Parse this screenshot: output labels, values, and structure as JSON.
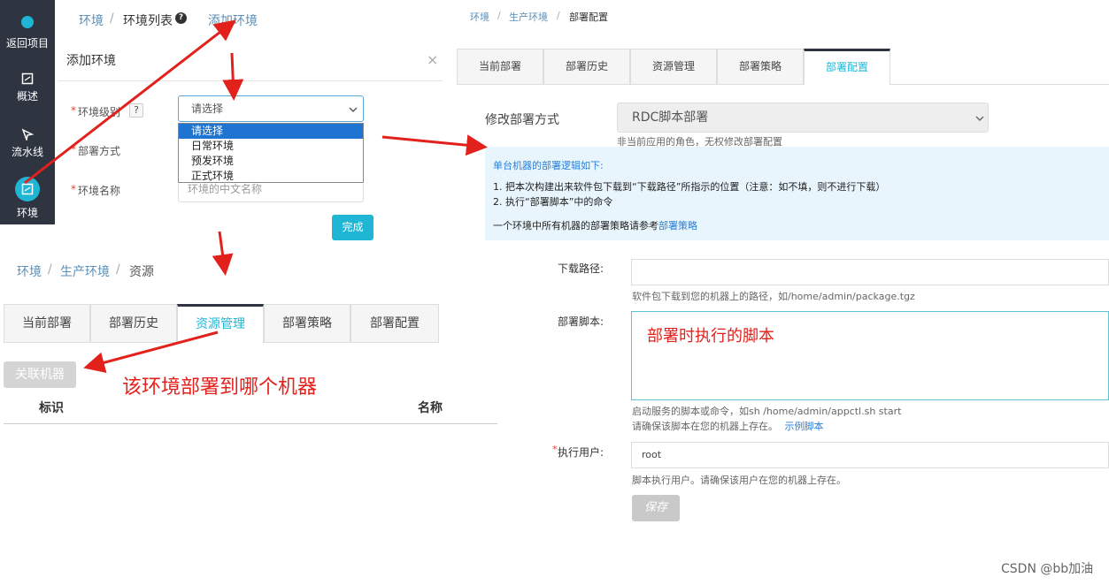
{
  "sidebar": {
    "items": [
      {
        "label": "返回项目",
        "icon": "back-icon"
      },
      {
        "label": "概述",
        "icon": "overview-icon"
      },
      {
        "label": "流水线",
        "icon": "pipeline-icon"
      },
      {
        "label": "环境",
        "icon": "environment-icon"
      }
    ],
    "accent": "#1fb6d6",
    "bg": "#2e3440"
  },
  "top_breadcrumb": {
    "root": "环境",
    "sep": "/",
    "list": "环境列表",
    "help_icon": "question-circle-icon",
    "action": "添加环境"
  },
  "dialog": {
    "title": "添加环境",
    "close": "×",
    "level_label": "环境级别",
    "help": "?",
    "select_value": "请选择",
    "options": [
      "请选择",
      "日常环境",
      "预发环境",
      "正式环境"
    ],
    "deploy_method_label": "部署方式",
    "env_name_label": "环境名称",
    "env_name_placeholder": "环境的中文名称",
    "required_mark": "*",
    "finish": "完成"
  },
  "bottom_left": {
    "breadcrumb": {
      "root": "环境",
      "sep": "/",
      "mid": "生产环境",
      "cur": "资源"
    },
    "tabs": [
      "当前部署",
      "部署历史",
      "资源管理",
      "部署策略",
      "部署配置"
    ],
    "active_tab": 2,
    "associate_button": "关联机器",
    "annotation": "该环境部署到哪个机器",
    "columns": [
      "标识",
      "名称"
    ]
  },
  "right": {
    "breadcrumb": {
      "root": "环境",
      "sep": "/",
      "mid": "生产环境",
      "cur": "部署配置"
    },
    "tabs": [
      "当前部署",
      "部署历史",
      "资源管理",
      "部署策略",
      "部署配置"
    ],
    "active_tab": 4,
    "modify_label": "修改部署方式",
    "modify_value": "RDC脚本部署",
    "modify_hint": "非当前应用的角色，无权修改部署配置",
    "info": {
      "title": "单台机器的部署逻辑如下:",
      "line1": "1. 把本次构建出来软件包下载到“下载路径”所指示的位置（注意：如不填，则不进行下载）",
      "line2": "2. 执行“部署脚本”中的命令",
      "line3_prefix": "一个环境中所有机器的部署策略请参考",
      "line3_link": "部署策略"
    },
    "download_label": "下载路径:",
    "download_help": "软件包下载到您的机器上的路径，如/home/admin/package.tgz",
    "script_label": "部署脚本:",
    "script_annotation": "部署时执行的脚本",
    "script_help1": "启动服务的脚本或命令，如sh /home/admin/appctl.sh start",
    "script_help2_prefix": "请确保该脚本在您的机器上存在。",
    "script_help2_link": "示例脚本",
    "user_label": "执行用户:",
    "user_value": "root",
    "user_help": "脚本执行用户。请确保该用户在您的机器上存在。",
    "save": "保存"
  },
  "watermark": "CSDN @bb加油",
  "colors": {
    "accent": "#1fb6d6",
    "annotation_red": "#e2211c",
    "link": "#2c7fd6",
    "info_bg": "#e8f5fc"
  }
}
